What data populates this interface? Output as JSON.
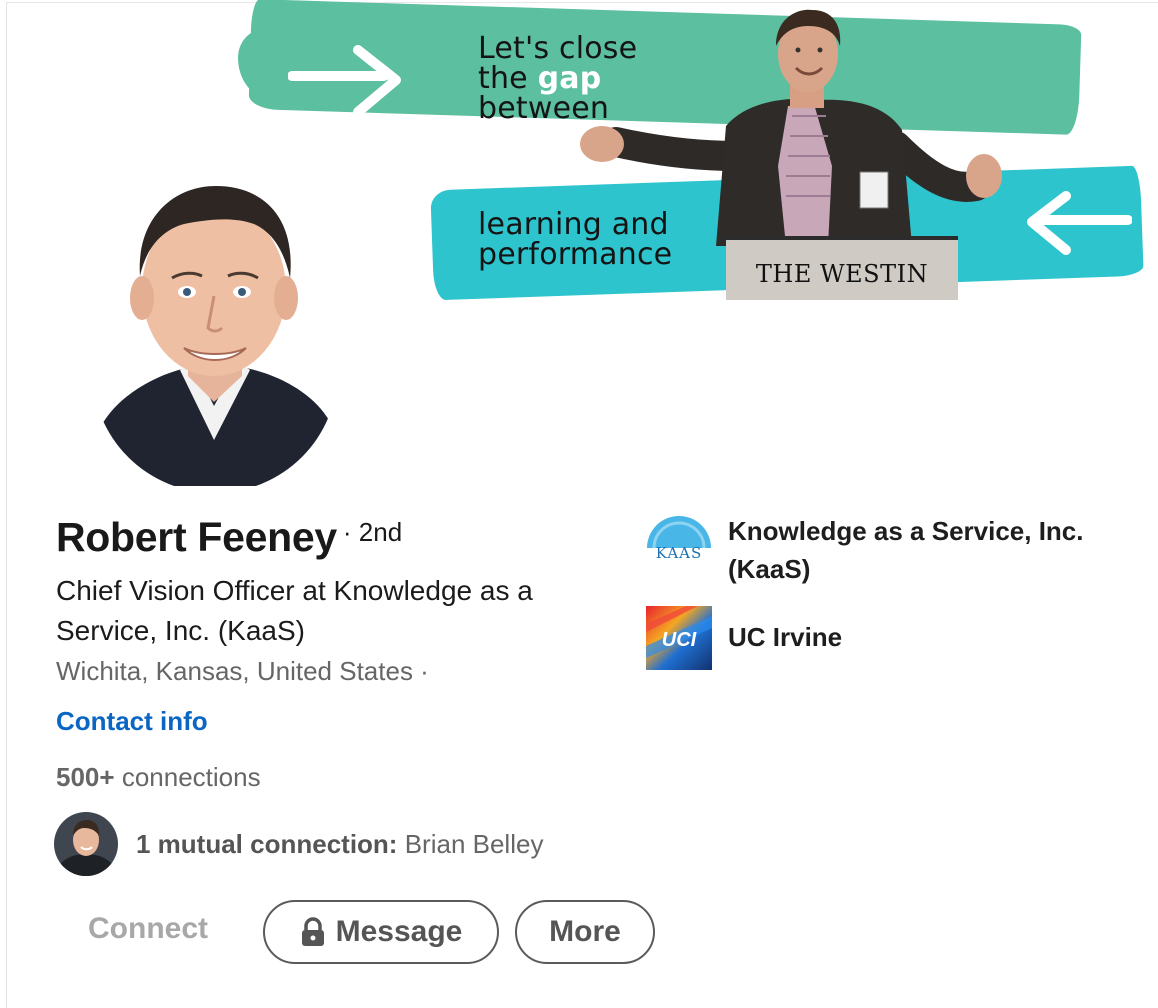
{
  "banner": {
    "line1": "Let's close",
    "line2_prefix": "the",
    "line2_highlight": "gap",
    "line3": "between",
    "line4": "learning and",
    "line5": "performance",
    "podium_label": "THE WESTIN",
    "colors": {
      "top_stroke": "#5bbfa0",
      "bottom_stroke": "#2ec4cd"
    }
  },
  "profile": {
    "name": "Robert Feeney",
    "degree": "· 2nd",
    "headline": "Chief Vision Officer at Knowledge as a Service, Inc. (KaaS)",
    "location": "Wichita, Kansas, United States ·",
    "contact_label": "Contact info",
    "connections_count": "500+",
    "connections_label": "connections",
    "mutual_label": "1 mutual connection:",
    "mutual_name": "Brian Belley"
  },
  "actions": {
    "connect": "Connect",
    "message": "Message",
    "more": "More"
  },
  "organizations": [
    {
      "name": "Knowledge as a Service, Inc. (KaaS)",
      "logo_text": "KAAS",
      "icon": "kaas-logo"
    },
    {
      "name": "UC Irvine",
      "logo_text": "UCI",
      "icon": "uci-logo"
    }
  ],
  "colors": {
    "link": "#0a66c2",
    "muted_text": "#666666",
    "connect_disabled": "#a8a8a8"
  }
}
